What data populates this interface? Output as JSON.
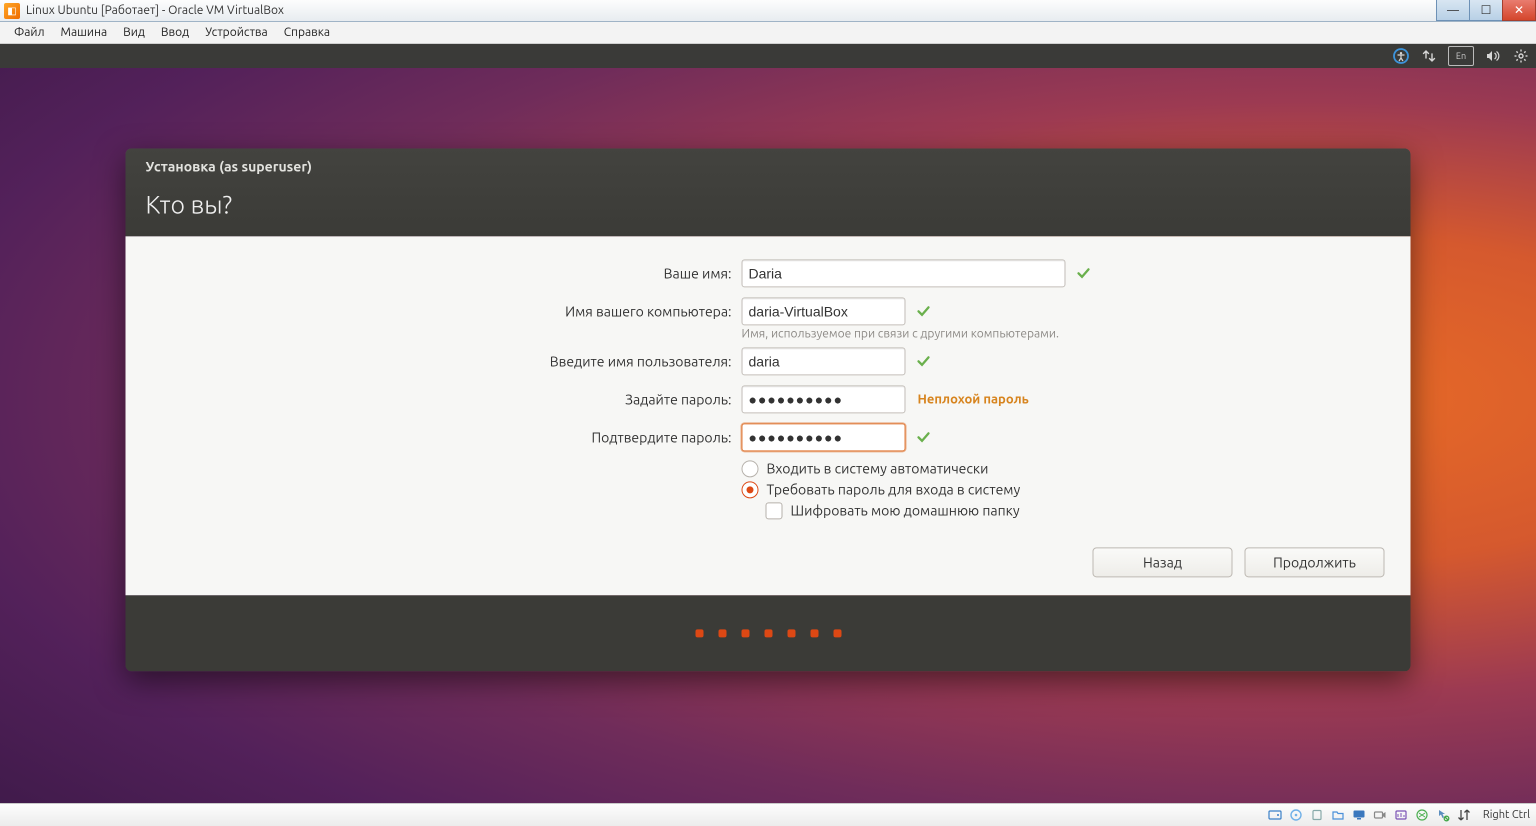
{
  "win_title": "Linux Ubuntu [Работает] - Oracle VM VirtualBox",
  "vb_menu": [
    "Файл",
    "Машина",
    "Вид",
    "Ввод",
    "Устройства",
    "Справка"
  ],
  "ubu_keyboard": "En",
  "installer": {
    "caption": "Установка (as superuser)",
    "title": "Кто вы?",
    "labels": {
      "name": "Ваше имя:",
      "computer": "Имя вашего компьютера:",
      "computer_hint": "Имя, используемое при связи с другими компьютерами.",
      "username": "Введите имя пользователя:",
      "password": "Задайте пароль:",
      "password2": "Подтвердите пароль:"
    },
    "values": {
      "name": "Daria",
      "computer": "daria-VirtualBox",
      "username": "daria",
      "password": "●●●●●●●●●●",
      "password2": "●●●●●●●●●●"
    },
    "password_strength": "Неплохой пароль",
    "options": {
      "auto_login": "Входить в систему автоматически",
      "require_pw": "Требовать пароль для входа в систему",
      "encrypt": "Шифровать мою домашнюю папку"
    },
    "buttons": {
      "back": "Назад",
      "next": "Продолжить"
    }
  },
  "vb_status": {
    "host": "Right Ctrl"
  }
}
